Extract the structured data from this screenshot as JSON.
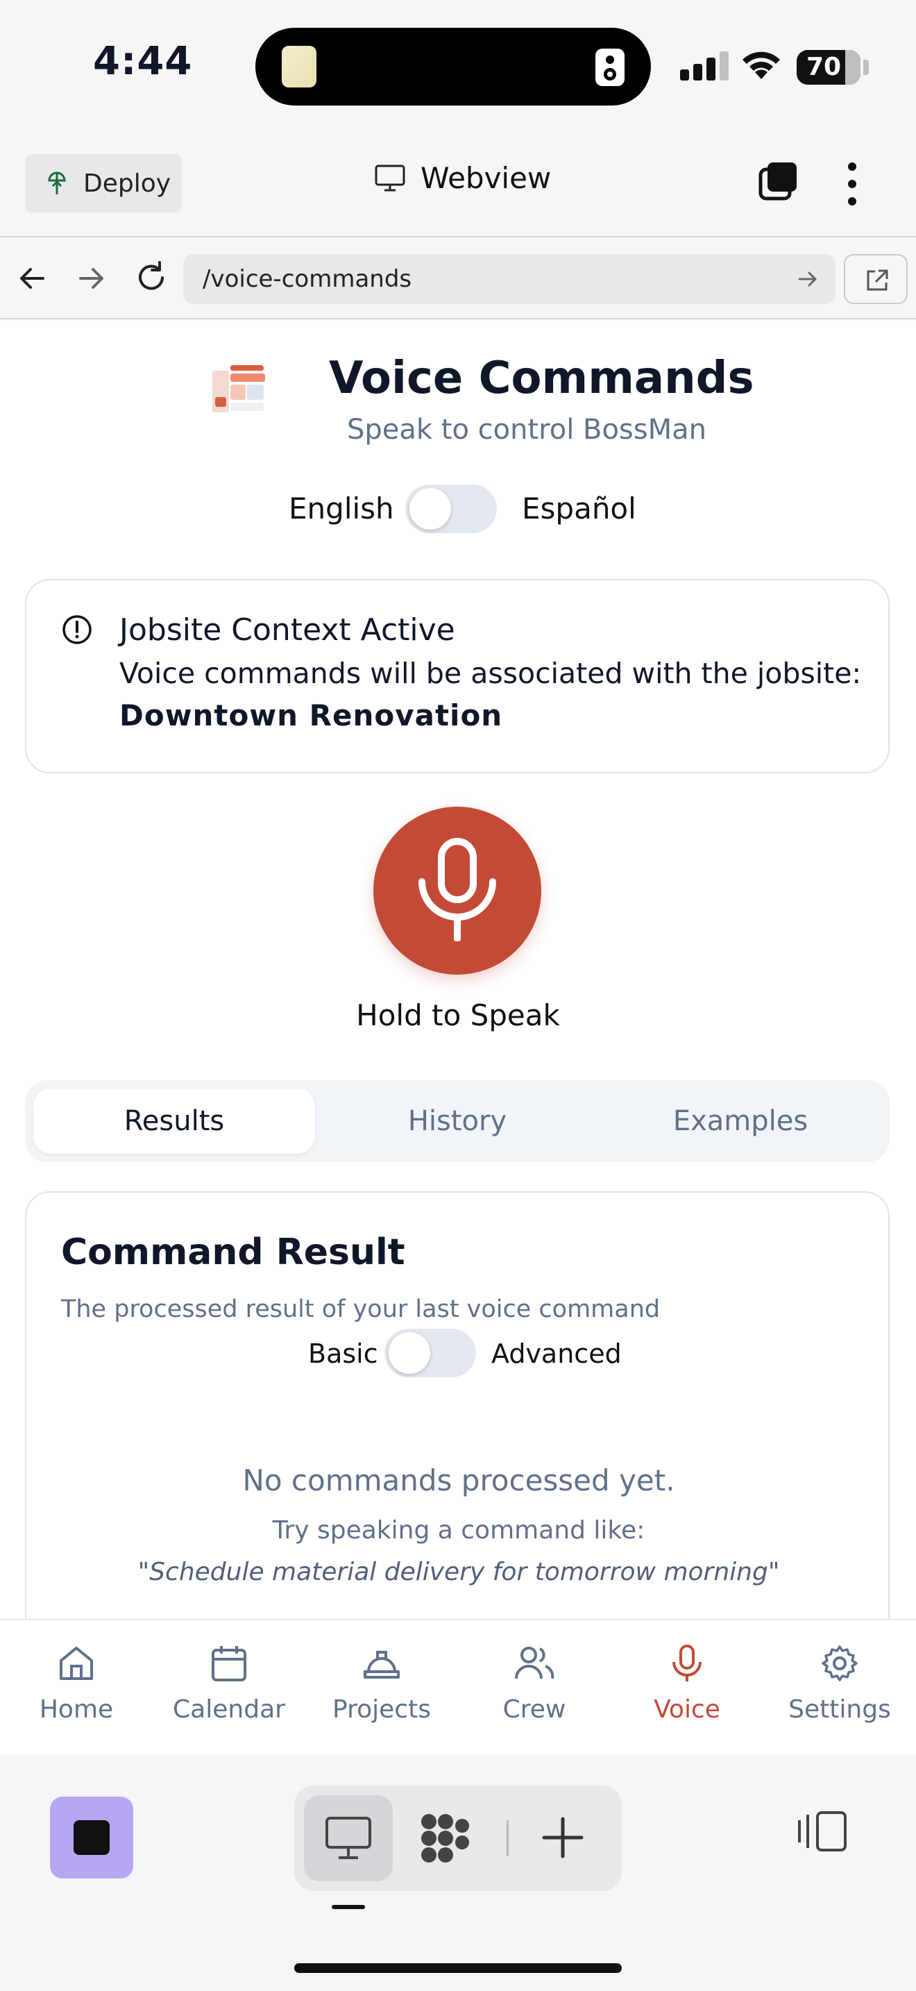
{
  "status_bar": {
    "time": "4:44",
    "battery": "70"
  },
  "header": {
    "deploy_label": "Deploy",
    "title": "Webview"
  },
  "url_bar": {
    "url": "/voice-commands"
  },
  "page": {
    "title": "Voice Commands",
    "subtitle": "Speak to control BossMan",
    "language": {
      "left": "English",
      "right": "Español",
      "selected": "English"
    },
    "context_card": {
      "title": "Jobsite Context Active",
      "body": "Voice commands will be associated with the jobsite:",
      "jobsite": "Downtown Renovation"
    },
    "mic": {
      "label": "Hold to Speak"
    },
    "tabs": [
      {
        "label": "Results",
        "active": true
      },
      {
        "label": "History",
        "active": false
      },
      {
        "label": "Examples",
        "active": false
      }
    ],
    "result_card": {
      "title": "Command Result",
      "description": "The processed result of your last voice command",
      "mode_left": "Basic",
      "mode_right": "Advanced",
      "empty_title": "No commands processed yet.",
      "empty_hint": "Try speaking a command like:",
      "empty_example": "\"Schedule material delivery for tomorrow morning\""
    }
  },
  "bottom_nav": {
    "items": [
      {
        "label": "Home",
        "icon": "home-icon"
      },
      {
        "label": "Calendar",
        "icon": "calendar-icon"
      },
      {
        "label": "Projects",
        "icon": "hard-hat-icon"
      },
      {
        "label": "Crew",
        "icon": "users-icon"
      },
      {
        "label": "Voice",
        "icon": "mic-icon",
        "active": true
      },
      {
        "label": "Settings",
        "icon": "gear-icon"
      }
    ]
  },
  "colors": {
    "accent": "#c34a36",
    "muted_text": "#607089",
    "stop_button": "#b8a6f2"
  }
}
